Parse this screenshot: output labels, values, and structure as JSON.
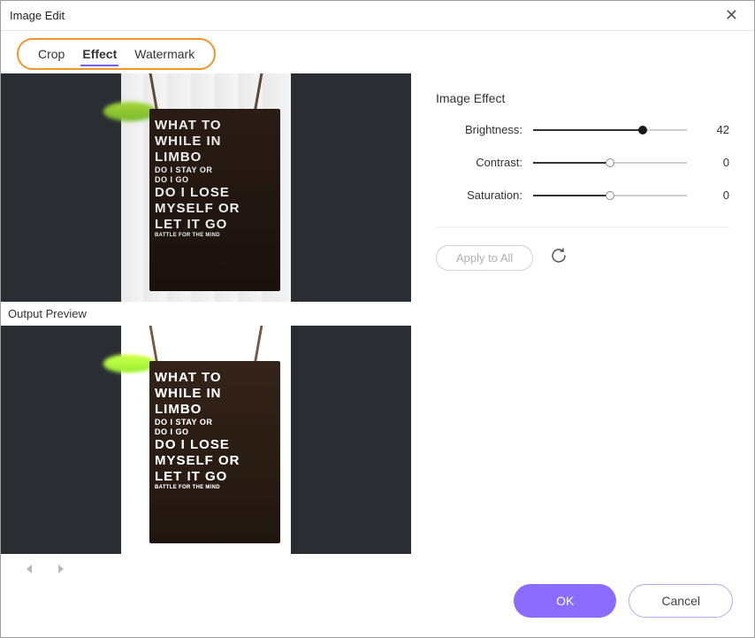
{
  "window": {
    "title": "Image Edit"
  },
  "tabs": {
    "crop": "Crop",
    "effect": "Effect",
    "watermark": "Watermark"
  },
  "preview": {
    "output_label": "Output Preview",
    "board_lines": {
      "l1": "WHAT TO",
      "l2": "WHILE IN",
      "l3": "LIMBO",
      "l4": "DO I STAY OR",
      "l5": "DO I GO",
      "l6": "DO I LOSE",
      "l7": "MYSELF OR",
      "l8": "LET IT GO",
      "l9": "BATTLE FOR THE MIND"
    }
  },
  "panel": {
    "title": "Image Effect",
    "brightness": {
      "label": "Brightness:",
      "value": 42,
      "min": -100,
      "max": 100
    },
    "contrast": {
      "label": "Contrast:",
      "value": 0,
      "min": -100,
      "max": 100
    },
    "saturation": {
      "label": "Saturation:",
      "value": 0,
      "min": -100,
      "max": 100
    },
    "apply_label": "Apply to All"
  },
  "footer": {
    "ok": "OK",
    "cancel": "Cancel"
  }
}
